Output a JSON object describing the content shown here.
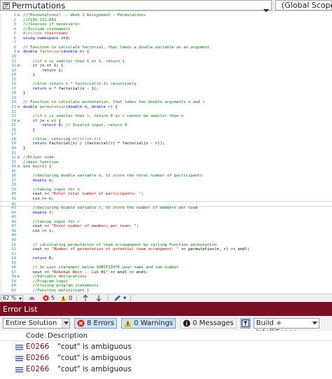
{
  "nav": {
    "file_combo": "Permutations",
    "scope_combo": "(Global Scope)"
  },
  "code_lines": [
    {
      "n": "1",
      "fold": "⊟",
      "parts": [
        {
          "t": "//*Permutations* -- Week 2 Assignment - Permutations",
          "c": "comment"
        }
      ]
    },
    {
      "n": "2",
      "parts": [
        {
          "t": "//CSIS 111-D01",
          "c": "comment"
        }
      ]
    },
    {
      "n": "3",
      "parts": [
        {
          "t": "//<Sources if necessary>",
          "c": "comment"
        }
      ]
    },
    {
      "n": "4",
      "parts": [
        {
          "t": "//Include statements",
          "c": "comment"
        }
      ]
    },
    {
      "n": "5",
      "parts": [
        {
          "t": "#include ",
          "c": "preproc"
        },
        {
          "t": "<iostream>",
          "c": "string"
        }
      ]
    },
    {
      "n": "6",
      "parts": [
        {
          "t": "using namespace ",
          "c": "keyword"
        },
        {
          "t": "std;",
          "c": "plain"
        }
      ]
    },
    {
      "n": "7",
      "parts": []
    },
    {
      "n": "8",
      "parts": [
        {
          "t": "// Function to calculate factorial, that takes a double variable as an argument",
          "c": "comment"
        }
      ]
    },
    {
      "n": "9",
      "fold": "⊟",
      "parts": [
        {
          "t": "double ",
          "c": "keyword"
        },
        {
          "t": "factorial",
          "c": "func"
        },
        {
          "t": "(",
          "c": "plain"
        },
        {
          "t": "double ",
          "c": "keyword"
        },
        {
          "t": "n) {",
          "c": "plain"
        }
      ]
    },
    {
      "n": "10",
      "parts": []
    },
    {
      "n": "11",
      "parts": [
        {
          "t": "    //if n is smaller than 1 or 1, return 1",
          "c": "comment"
        }
      ]
    },
    {
      "n": "12",
      "fold": "⊟",
      "parts": [
        {
          "t": "    if ",
          "c": "keyword"
        },
        {
          "t": "(n <= 1) {",
          "c": "plain"
        }
      ]
    },
    {
      "n": "13",
      "parts": [
        {
          "t": "        return ",
          "c": "keyword"
        },
        {
          "t": "1;",
          "c": "plain"
        }
      ]
    },
    {
      "n": "14",
      "parts": [
        {
          "t": "    }",
          "c": "plain"
        }
      ]
    },
    {
      "n": "15",
      "parts": []
    },
    {
      "n": "16",
      "parts": [
        {
          "t": "    //else return n * factorial(n-1) recursively",
          "c": "comment"
        }
      ]
    },
    {
      "n": "17",
      "parts": [
        {
          "t": "    return ",
          "c": "keyword"
        },
        {
          "t": "n * factorial(n - 1);",
          "c": "plain"
        }
      ]
    },
    {
      "n": "18",
      "parts": [
        {
          "t": "}",
          "c": "plain"
        }
      ]
    },
    {
      "n": "19",
      "parts": []
    },
    {
      "n": "20",
      "parts": [
        {
          "t": "// Function to calculate permutation, that takes two double arguments n and r",
          "c": "comment"
        }
      ]
    },
    {
      "n": "21",
      "fold": "⊟",
      "parts": [
        {
          "t": "double ",
          "c": "keyword"
        },
        {
          "t": "permutation",
          "c": "func"
        },
        {
          "t": "(",
          "c": "plain"
        },
        {
          "t": "double ",
          "c": "keyword"
        },
        {
          "t": "n, ",
          "c": "plain"
        },
        {
          "t": "double ",
          "c": "keyword"
        },
        {
          "t": "r) {",
          "c": "plain"
        }
      ]
    },
    {
      "n": "22",
      "parts": []
    },
    {
      "n": "23",
      "parts": [
        {
          "t": "    //if n is smaller than r, return 0 as r cannot be smaller than n",
          "c": "comment"
        }
      ]
    },
    {
      "n": "24",
      "fold": "⊟",
      "parts": [
        {
          "t": "    if ",
          "c": "keyword"
        },
        {
          "t": "(n < r) {",
          "c": "plain"
        }
      ]
    },
    {
      "n": "25",
      "parts": [
        {
          "t": "        return ",
          "c": "keyword"
        },
        {
          "t": "0; ",
          "c": "plain"
        },
        {
          "t": "// Invalid input, return 0",
          "c": "comment"
        }
      ]
    },
    {
      "n": "26",
      "parts": [
        {
          "t": "    }",
          "c": "plain"
        }
      ]
    },
    {
      "n": "27",
      "parts": []
    },
    {
      "n": "28",
      "parts": [
        {
          "t": "    //else, returing n!/(r!(n-r))",
          "c": "comment"
        }
      ]
    },
    {
      "n": "29",
      "parts": [
        {
          "t": "    return ",
          "c": "keyword"
        },
        {
          "t": "factorial(n) / (factorial(r) * factorial(n - r));",
          "c": "plain"
        }
      ]
    },
    {
      "n": "30",
      "parts": [
        {
          "t": "}",
          "c": "plain"
        }
      ]
    },
    {
      "n": "31",
      "parts": []
    },
    {
      "n": "32",
      "fold": "⊟",
      "parts": [
        {
          "t": "//Driver code",
          "c": "comment"
        }
      ]
    },
    {
      "n": "33",
      "parts": [
        {
          "t": "//main function",
          "c": "comment"
        }
      ]
    },
    {
      "n": "34",
      "fold": "⊟",
      "parts": [
        {
          "t": "int ",
          "c": "keyword"
        },
        {
          "t": "main",
          "c": "func"
        },
        {
          "t": "() {",
          "c": "plain"
        }
      ]
    },
    {
      "n": "35",
      "parts": []
    },
    {
      "n": "36",
      "parts": [
        {
          "t": "    //declaring double variable n, to store the total number of participants",
          "c": "comment"
        }
      ]
    },
    {
      "n": "37",
      "parts": [
        {
          "t": "    double ",
          "c": "keyword"
        },
        {
          "t": "n;",
          "c": "plain"
        }
      ]
    },
    {
      "n": "38",
      "parts": []
    },
    {
      "n": "39",
      "parts": [
        {
          "t": "    //taking input for n",
          "c": "comment"
        }
      ]
    },
    {
      "n": "40",
      "parts": [
        {
          "t": "    cout << ",
          "c": "plain"
        },
        {
          "t": "\"Enter total number of participants: \"",
          "c": "string"
        },
        {
          "t": ";",
          "c": "plain"
        }
      ]
    },
    {
      "n": "41",
      "parts": [
        {
          "t": "    cin >> n;",
          "c": "plain"
        }
      ]
    },
    {
      "n": "42",
      "current": true,
      "parts": []
    },
    {
      "n": "43",
      "parts": [
        {
          "t": "    //declaring double variable r, to store the number of members per team",
          "c": "comment"
        }
      ]
    },
    {
      "n": "44",
      "parts": [
        {
          "t": "    double ",
          "c": "keyword"
        },
        {
          "t": "r;",
          "c": "plain"
        }
      ]
    },
    {
      "n": "45",
      "parts": []
    },
    {
      "n": "46",
      "parts": [
        {
          "t": "    //taking input for r",
          "c": "comment"
        }
      ]
    },
    {
      "n": "47",
      "parts": [
        {
          "t": "    cout << ",
          "c": "plain"
        },
        {
          "t": "\"Enter number of members per team: \"",
          "c": "string"
        },
        {
          "t": ";",
          "c": "plain"
        }
      ]
    },
    {
      "n": "48",
      "parts": [
        {
          "t": "    cin >> r;",
          "c": "plain"
        }
      ]
    },
    {
      "n": "49",
      "parts": []
    },
    {
      "n": "50",
      "parts": []
    },
    {
      "n": "51",
      "parts": [
        {
          "t": "    // calculating permutation of team arrangement by calling Function permutation",
          "c": "comment"
        }
      ]
    },
    {
      "n": "52",
      "parts": [
        {
          "t": "    cout << ",
          "c": "plain"
        },
        {
          "t": "\"Number of permutation of potential team arrangment: \"",
          "c": "string"
        },
        {
          "t": " << permutation(n, r) << endl;",
          "c": "plain"
        }
      ]
    },
    {
      "n": "53",
      "parts": []
    },
    {
      "n": "54",
      "parts": [
        {
          "t": "    return ",
          "c": "keyword"
        },
        {
          "t": "0;",
          "c": "plain"
        }
      ]
    },
    {
      "n": "55",
      "parts": []
    },
    {
      "n": "56",
      "parts": [
        {
          "t": "    // In cout statement below SUBSTITUTE your name and lab number",
          "c": "comment"
        }
      ]
    },
    {
      "n": "57",
      "parts": [
        {
          "t": "    cout << ",
          "c": "plain"
        },
        {
          "t": "\"Rebekah West -- Lab #2\"",
          "c": "string"
        },
        {
          "t": " << endl << endl;",
          "c": "plain"
        }
      ]
    },
    {
      "n": "58",
      "fold": "⊟",
      "parts": [
        {
          "t": "    //Variable declarations",
          "c": "comment"
        }
      ]
    },
    {
      "n": "59",
      "parts": [
        {
          "t": "    //Program logic",
          "c": "comment"
        }
      ]
    },
    {
      "n": "60",
      "parts": [
        {
          "t": "    //Closing program statements",
          "c": "comment"
        }
      ]
    },
    {
      "n": "61",
      "parts": [
        {
          "t": "    //Function definitions }",
          "c": "comment"
        }
      ]
    }
  ],
  "statusbar": {
    "zoom": "62 %",
    "errors": "5",
    "warnings": "0"
  },
  "error_list": {
    "title": "Error List",
    "scope": "Entire Solution",
    "errors_btn": "8 Errors",
    "warnings_btn": "0 Warnings",
    "messages_btn": "0 Messages",
    "build_select": "Build + IntelliSense",
    "col_code": "Code",
    "col_desc": "Description",
    "rows": [
      {
        "code": "E0266",
        "desc": "\"cout\" is ambiguous"
      },
      {
        "code": "E0266",
        "desc": "\"cout\" is ambiguous"
      },
      {
        "code": "E0266",
        "desc": "\"cout\" is ambiguous"
      }
    ]
  },
  "colors": {
    "error_header": "#7a0e24",
    "line_numbers": "#2b91af",
    "comment": "#008000",
    "keyword": "#0000ff",
    "string": "#a31515"
  }
}
